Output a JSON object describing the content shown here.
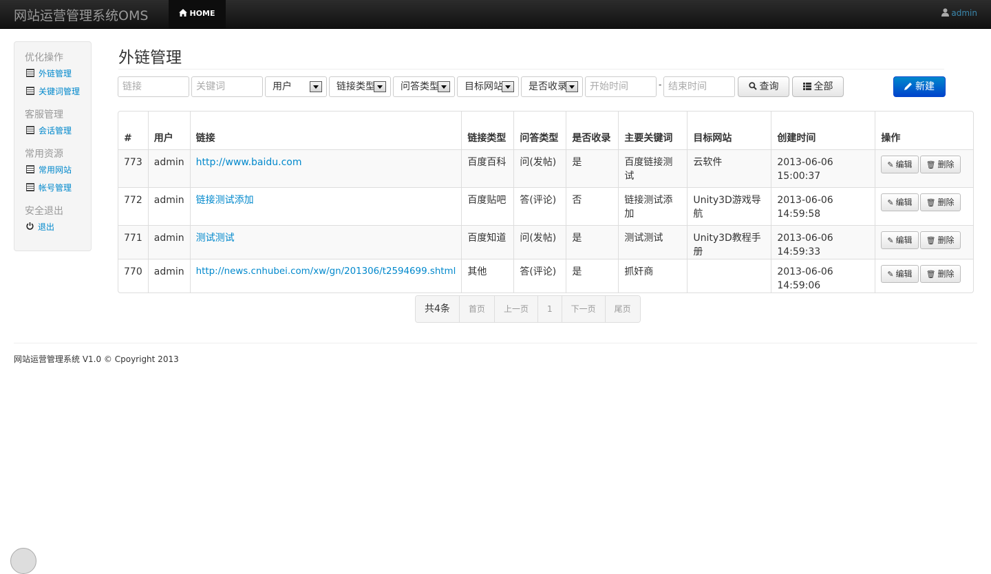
{
  "navbar": {
    "brand": "网站运营管理系统OMS",
    "home_label": "HOME",
    "user_label": "admin"
  },
  "sidebar": {
    "sections": [
      {
        "title": "优化操作",
        "items": [
          "外链管理",
          "关键词管理"
        ]
      },
      {
        "title": "客服管理",
        "items": [
          "会话管理"
        ]
      },
      {
        "title": "常用资源",
        "items": [
          "常用网站",
          "帐号管理"
        ]
      },
      {
        "title": "安全退出",
        "items": [
          "退出"
        ]
      }
    ]
  },
  "page": {
    "title": "外链管理"
  },
  "filters": {
    "link_placeholder": "链接",
    "keyword_placeholder": "关键词",
    "user_select": "用户",
    "link_type_select": "链接类型",
    "qa_type_select": "问答类型",
    "target_site_select": "目标网站",
    "indexed_select": "是否收录",
    "start_placeholder": "开始时间",
    "range_sep": "-",
    "end_placeholder": "结束时间",
    "query_label": "查询",
    "all_label": "全部",
    "new_label": "新建"
  },
  "table": {
    "headers": {
      "id": "#",
      "user": "用户",
      "link": "链接",
      "link_type": "链接类型",
      "qa_type": "问答类型",
      "indexed": "是否收录",
      "keyword": "主要关键词",
      "target": "目标网站",
      "created": "创建时间",
      "ops": "操作"
    },
    "rows": [
      {
        "id": "773",
        "user": "admin",
        "link": "http://www.baidu.com",
        "link_type": "百度百科",
        "qa_type": "问(发帖)",
        "indexed": "是",
        "keyword": "百度链接测试",
        "target": "云软件",
        "created": "2013-06-06 15:00:37"
      },
      {
        "id": "772",
        "user": "admin",
        "link": "链接测试添加",
        "link_type": "百度贴吧",
        "qa_type": "答(评论)",
        "indexed": "否",
        "keyword": "链接测试添加",
        "target": "Unity3D游戏导航",
        "created": "2013-06-06 14:59:58"
      },
      {
        "id": "771",
        "user": "admin",
        "link": "测试测试",
        "link_type": "百度知道",
        "qa_type": "问(发帖)",
        "indexed": "是",
        "keyword": "测试测试",
        "target": "Unity3D教程手册",
        "created": "2013-06-06 14:59:33"
      },
      {
        "id": "770",
        "user": "admin",
        "link": "http://news.cnhubei.com/xw/gn/201306/t2594699.shtml",
        "link_type": "其他",
        "qa_type": "答(评论)",
        "indexed": "是",
        "keyword": "抓奸商",
        "target": "",
        "created": "2013-06-06 14:59:06"
      }
    ],
    "edit_label": "编辑",
    "delete_label": "删除"
  },
  "pagination": {
    "total": "共4条",
    "first": "首页",
    "prev": "上一页",
    "current": "1",
    "next": "下一页",
    "last": "尾页"
  },
  "footer": {
    "text": "网站运营管理系统 V1.0 © Cpoyright 2013"
  },
  "colors": {
    "accent": "#0088cc",
    "yes": "#468847",
    "no": "#b94a48",
    "navbar": "#1b1b1b"
  }
}
